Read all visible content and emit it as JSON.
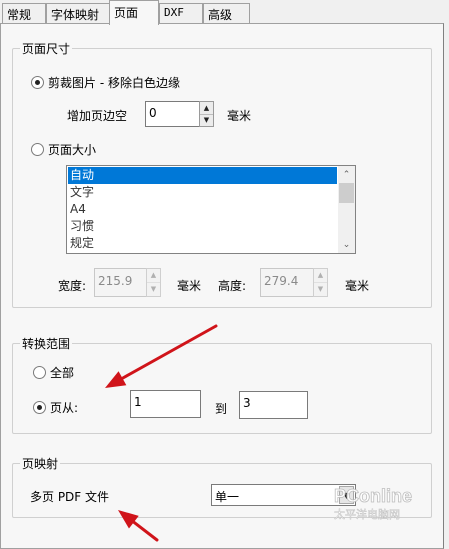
{
  "tabs": [
    {
      "label": "常规"
    },
    {
      "label": "字体映射"
    },
    {
      "label": "页面"
    },
    {
      "label": "DXF"
    },
    {
      "label": "高级"
    }
  ],
  "active_tab": "页面",
  "page_size": {
    "group_title": "页面尺寸",
    "crop_option": {
      "label": "剪裁图片 - 移除白色边缘",
      "checked": true
    },
    "margin_label": "增加页边空",
    "margin_value": "0",
    "margin_unit": "毫米",
    "page_size_option": {
      "label": "页面大小",
      "checked": false
    },
    "size_list": {
      "items": [
        "自动",
        "文字",
        "A4",
        "习惯",
        "规定"
      ],
      "selected": "自动"
    },
    "width_label": "宽度:",
    "width_value": "215.9",
    "width_unit": "毫米",
    "height_label": "高度:",
    "height_value": "279.4",
    "height_unit": "毫米"
  },
  "range": {
    "group_title": "转换范围",
    "all_option": {
      "label": "全部",
      "checked": false
    },
    "pages_option": {
      "label": "页从:",
      "checked": true
    },
    "from_value": "1",
    "to_label": "到",
    "to_value": "3"
  },
  "page_mapping": {
    "group_title": "页映射",
    "multipage_label": "多页 PDF 文件",
    "multipage_value": "单一"
  },
  "watermark": {
    "brand": "PConline",
    "subtitle": "太平洋电脑网"
  },
  "annotation": {
    "arrow_color": "#d0141a"
  },
  "icons": {
    "spin_up": "▲",
    "spin_down": "▼",
    "scroll_up": "⌃",
    "scroll_down": "⌄",
    "combo_arrow": "▼"
  }
}
